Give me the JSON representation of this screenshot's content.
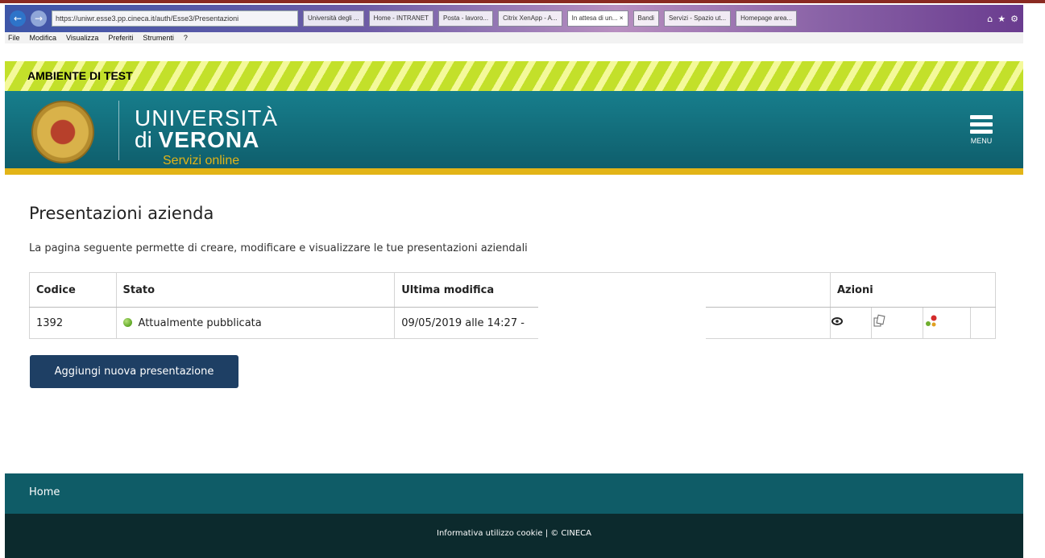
{
  "browser": {
    "address": "https://uniwr.esse3.pp.cineca.it/auth/Esse3/Presentazioni",
    "tabs": [
      "Università degli ...",
      "Home - INTRANET",
      "Posta - lavoro...",
      "Citrix XenApp - A...",
      "In attesa di un... ×",
      "Bandi",
      "Servizi - Spazio ut...",
      "Homepage area..."
    ],
    "menu": [
      "File",
      "Modifica",
      "Visualizza",
      "Preferiti",
      "Strumenti",
      "?"
    ]
  },
  "banner": {
    "text": "AMBIENTE DI TEST"
  },
  "header": {
    "line1": "UNIVERSITÀ",
    "line2_prefix": "di",
    "line2_bold": "VERONA",
    "subtitle": "Servizi online",
    "menu_label": "MENU"
  },
  "main": {
    "title": "Presentazioni azienda",
    "description": "La pagina seguente permette di creare, modificare e visualizzare le tue presentazioni aziendali",
    "table": {
      "headers": {
        "codice": "Codice",
        "stato": "Stato",
        "ultima": "Ultima modifica",
        "azioni": "Azioni"
      },
      "rows": [
        {
          "codice": "1392",
          "stato": "Attualmente pubblicata",
          "ultima": "09/05/2019 alle 14:27 -"
        }
      ]
    },
    "add_button": "Aggiungi nuova presentazione"
  },
  "footer": {
    "home": "Home",
    "copyright": "Informativa utilizzo cookie | © CINECA"
  },
  "colors": {
    "header": "#177e8c",
    "gold": "#e2b417",
    "button": "#1e3f64",
    "footer": "#0f5c67",
    "footer_dark": "#0c2a2d"
  }
}
